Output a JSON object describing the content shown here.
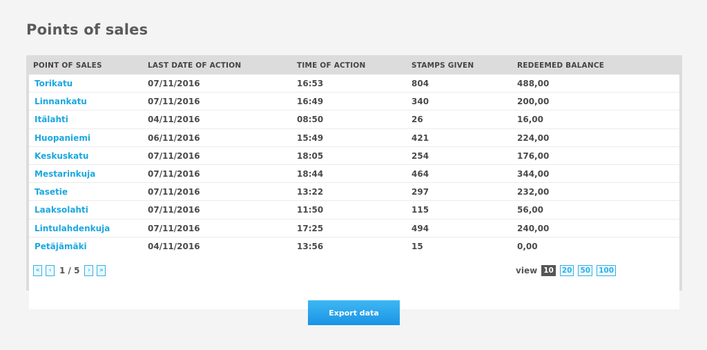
{
  "page": {
    "title": "Points of sales"
  },
  "table": {
    "columns": [
      "POINT OF SALES",
      "LAST DATE OF ACTION",
      "TIME OF ACTION",
      "STAMPS GIVEN",
      "REDEEMED BALANCE"
    ],
    "rows": [
      [
        "Torikatu",
        "07/11/2016",
        "16:53",
        "804",
        "488,00"
      ],
      [
        "Linnankatu",
        "07/11/2016",
        "16:49",
        "340",
        "200,00"
      ],
      [
        "Itälahti",
        "04/11/2016",
        "08:50",
        "26",
        "16,00"
      ],
      [
        "Huopaniemi",
        "06/11/2016",
        "15:49",
        "421",
        "224,00"
      ],
      [
        "Keskuskatu",
        "07/11/2016",
        "18:05",
        "254",
        "176,00"
      ],
      [
        "Mestarinkuja",
        "07/11/2016",
        "18:44",
        "464",
        "344,00"
      ],
      [
        "Tasetie",
        "07/11/2016",
        "13:22",
        "297",
        "232,00"
      ],
      [
        "Laaksolahti",
        "07/11/2016",
        "11:50",
        "115",
        "56,00"
      ],
      [
        "Lintulahdenkuja",
        "07/11/2016",
        "17:25",
        "494",
        "240,00"
      ],
      [
        "Petäjämäki",
        "04/11/2016",
        "13:56",
        "15",
        "0,00"
      ]
    ]
  },
  "pagination": {
    "first": "«",
    "prev": "‹",
    "info": "1 / 5",
    "next": "›",
    "last": "»"
  },
  "view": {
    "label": "view",
    "options": [
      "10",
      "20",
      "50",
      "100"
    ],
    "selected": "10"
  },
  "export": {
    "label": "Export data"
  },
  "colors": {
    "accent": "#1ca7e0",
    "panel": "#dcdcdc",
    "active_view": "#555555"
  }
}
